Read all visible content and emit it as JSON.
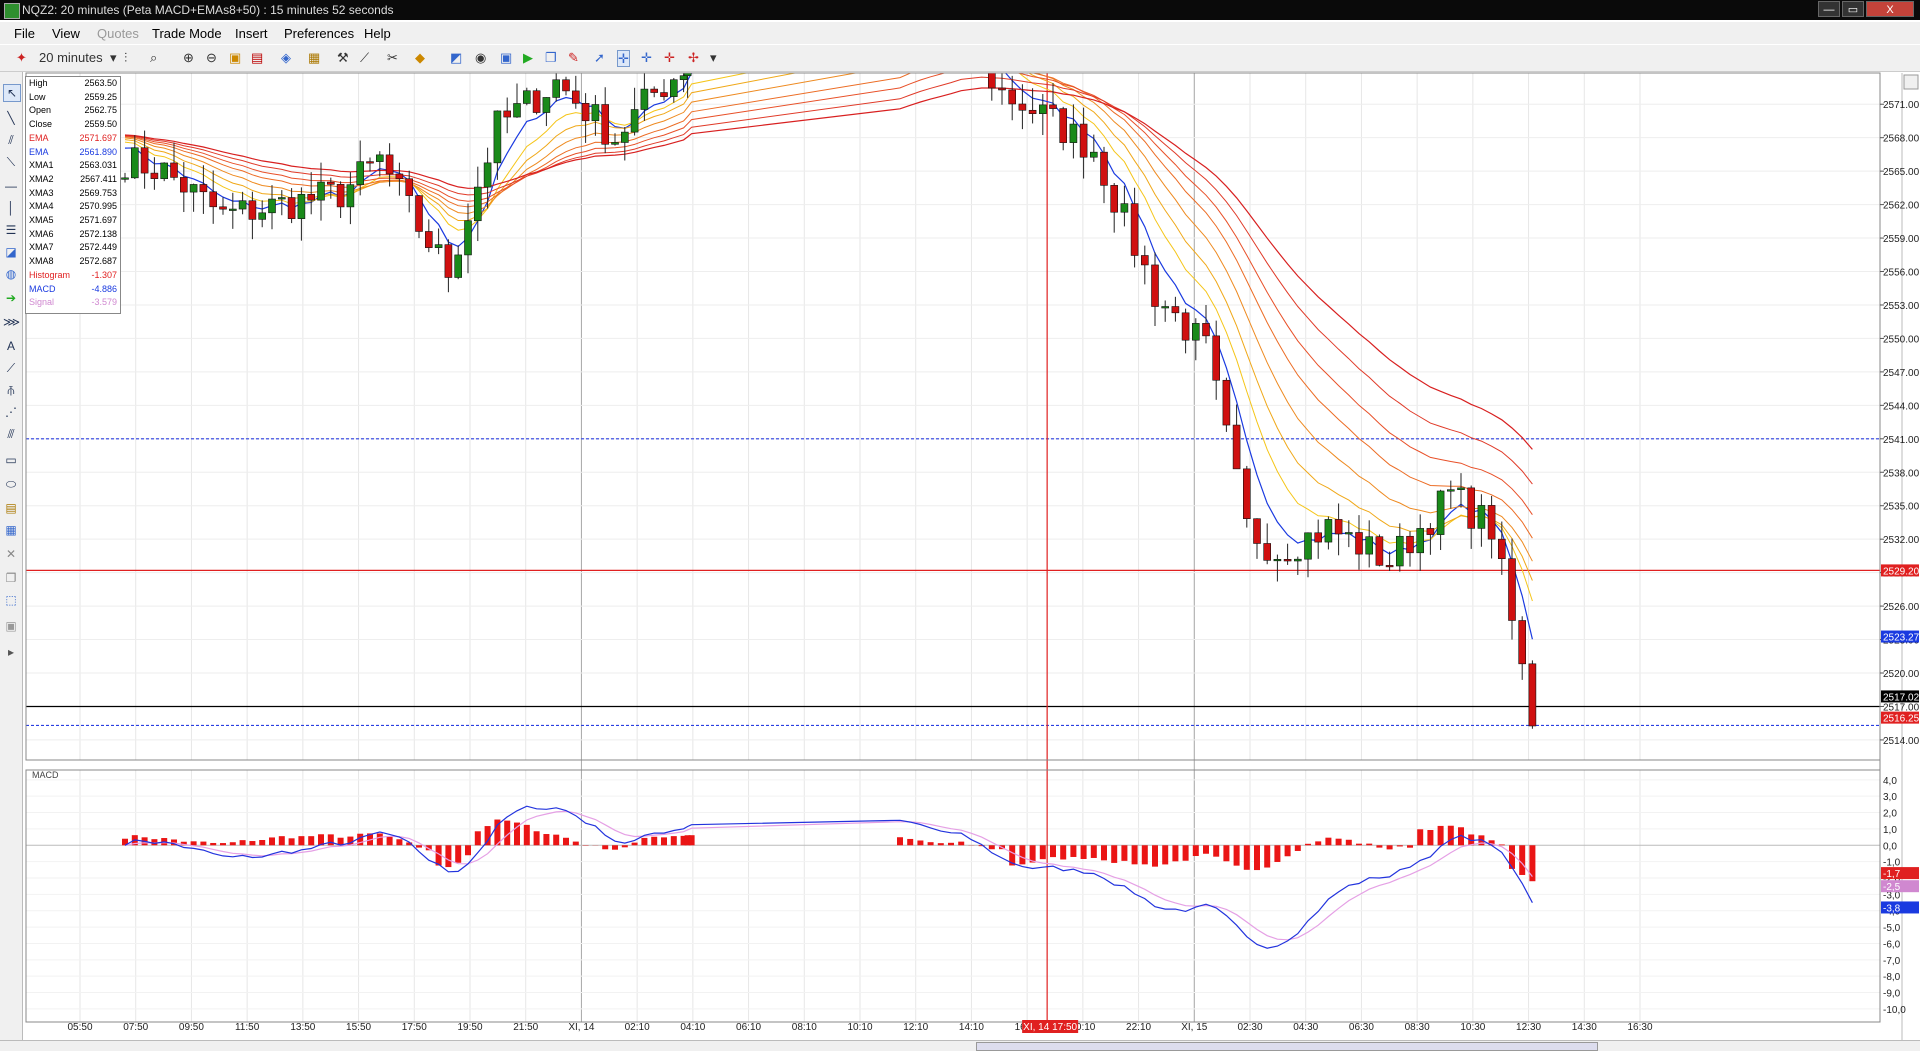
{
  "window": {
    "title": "NQZ2: 20 minutes (Peta MACD+EMAs8+50) : 15 minutes 52 seconds",
    "minimize": "—",
    "restore": "▭",
    "close": "X"
  },
  "menu": [
    "File",
    "View",
    "Quotes",
    "Trade Mode",
    "Insert",
    "Preferences",
    "Help"
  ],
  "menu_disabled": [
    "Quotes"
  ],
  "toolbar": {
    "interval": "20 minutes",
    "icons": [
      "pin-icon",
      "bar-type-icon",
      "zoom-icon",
      "zoom-in-icon",
      "zoom-out-icon",
      "lock-icon",
      "save-icon",
      "insert-icon",
      "chart-properties-icon",
      "drawing-icon",
      "trendline-icon",
      "scissors-icon",
      "color-icon",
      "link-icon",
      "print-icon",
      "play-icon",
      "copy-icon",
      "edit-icon",
      "pointer-icon",
      "crosshair-icon",
      "global-crosshair-icon",
      "dotted-crosshair-icon"
    ]
  },
  "left_tools": [
    "select-icon",
    "line-icon",
    "pencil-icon",
    "ray-icon",
    "horizontal-line-icon",
    "vertical-line-icon",
    "fib-icon",
    "text-icon",
    "callout-icon",
    "arrow-icon",
    "channel-icon",
    "text-label-icon",
    "gann-icon",
    "pitchfork-icon",
    "fan-icon",
    "andrews-icon",
    "rectangle-icon",
    "ellipse-icon",
    "snapshot-icon",
    "note-icon",
    "delete-icon",
    "layers-icon",
    "select-box-icon",
    "lock-icon",
    "play-icon"
  ],
  "data_window": [
    {
      "label": "High",
      "value": "2563.50",
      "color": "#000000"
    },
    {
      "label": "Low",
      "value": "2559.25",
      "color": "#000000"
    },
    {
      "label": "Open",
      "value": "2562.75",
      "color": "#000000"
    },
    {
      "label": "Close",
      "value": "2559.50",
      "color": "#000000"
    },
    {
      "label": "EMA",
      "value": "2571.697",
      "color": "#e02020"
    },
    {
      "label": "EMA",
      "value": "2561.890",
      "color": "#1a3ae0"
    },
    {
      "label": "XMA1",
      "value": "2563.031",
      "color": "#000000"
    },
    {
      "label": "XMA2",
      "value": "2567.411",
      "color": "#000000"
    },
    {
      "label": "XMA3",
      "value": "2569.753",
      "color": "#000000"
    },
    {
      "label": "XMA4",
      "value": "2570.995",
      "color": "#000000"
    },
    {
      "label": "XMA5",
      "value": "2571.697",
      "color": "#000000"
    },
    {
      "label": "XMA6",
      "value": "2572.138",
      "color": "#000000"
    },
    {
      "label": "XMA7",
      "value": "2572.449",
      "color": "#000000"
    },
    {
      "label": "XMA8",
      "value": "2572.687",
      "color": "#000000"
    },
    {
      "label": "Histogram",
      "value": "-1.307",
      "color": "#e02020"
    },
    {
      "label": "MACD",
      "value": "-4.886",
      "color": "#1a3ae0"
    },
    {
      "label": "Signal",
      "value": "-3.579",
      "color": "#d088d0"
    }
  ],
  "price_labels": [
    {
      "text": "2529.20",
      "bg": "#e02020",
      "fg": "#ffffff"
    },
    {
      "text": "2523.27",
      "bg": "#1a3ae0",
      "fg": "#ffffff"
    },
    {
      "text": "2517.02",
      "bg": "#000000",
      "fg": "#ffffff"
    },
    {
      "text": "2516.25",
      "bg": "#e02020",
      "fg": "#ffffff"
    }
  ],
  "macd_labels": [
    {
      "text": "-1,7",
      "bg": "#e02020",
      "fg": "#ffffff"
    },
    {
      "text": "-2,5",
      "bg": "#d088d0",
      "fg": "#ffffff"
    },
    {
      "text": "-3,8",
      "bg": "#1a3ae0",
      "fg": "#ffffff"
    }
  ],
  "cursor_time_label": "XI, 14 17:50",
  "macd_title": "MACD",
  "chart_data": {
    "type": "candlestick",
    "price_axis": {
      "ticks": [
        "2571.00",
        "2568.00",
        "2565.00",
        "2562.00",
        "2559.00",
        "2556.00",
        "2553.00",
        "2550.00",
        "2547.00",
        "2544.00",
        "2541.00",
        "2538.00",
        "2535.00",
        "2532.00",
        "2529.00",
        "2526.00",
        "2523.00",
        "2520.00",
        "2517.00",
        "2514.00"
      ],
      "range": [
        2512.2,
        2573.8
      ]
    },
    "macd_axis": {
      "ticks": [
        "4,0",
        "3,0",
        "2,0",
        "1,0",
        "0,0",
        "-1,0",
        "-2,0",
        "-3,0",
        "-4,0",
        "-5,0",
        "-6,0",
        "-7,0",
        "-8,0",
        "-9,0",
        "-10,0"
      ],
      "range": [
        -10.8,
        4.6
      ]
    },
    "time_axis": [
      "05:50",
      "07:50",
      "09:50",
      "11:50",
      "13:50",
      "15:50",
      "17:50",
      "19:50",
      "21:50",
      "XI, 14",
      "02:10",
      "04:10",
      "06:10",
      "08:10",
      "10:10",
      "12:10",
      "14:10",
      "16:10",
      "20:10",
      "22:10",
      "XI, 15",
      "02:30",
      "04:30",
      "06:30",
      "08:30",
      "10:30",
      "12:30",
      "14:30",
      "16:30"
    ],
    "horizontal_lines": [
      {
        "price": 2541.0,
        "color": "#2a3ee0",
        "style": "dotted"
      },
      {
        "price": 2529.2,
        "color": "#e02020",
        "style": "solid"
      },
      {
        "price": 2517.0,
        "color": "#000000",
        "style": "solid"
      },
      {
        "price": 2515.3,
        "color": "#2a3ee0",
        "style": "dotted"
      }
    ],
    "candle_colors": {
      "up": "#1a8a1a",
      "down": "#d01010"
    },
    "candles_visible_summary": "approx. 128 visible 20-minute bars from 05:50 to 16:30 next day",
    "segments": [
      {
        "from": "05:50",
        "to": "15:50",
        "trend": "chop",
        "range": [
          2553.0,
          2571.0
        ]
      },
      {
        "from": "15:50",
        "to": "21:50",
        "trend": "rebound",
        "range": [
          2560.0,
          2576.0
        ]
      },
      {
        "from": "14:10",
        "to": "16:10",
        "trend": "high",
        "range": [
          2569.0,
          2574.0
        ]
      },
      {
        "from": "16:10",
        "to": "22:10",
        "trend": "sharp decline",
        "range": [
          2529.0,
          2573.0
        ]
      },
      {
        "from": "22:10",
        "to": "12:30",
        "trend": "consolidation",
        "range": [
          2528.0,
          2538.0
        ]
      },
      {
        "from": "14:30",
        "to": "16:30",
        "trend": "breakdown",
        "range": [
          2515.0,
          2539.0
        ]
      }
    ]
  }
}
